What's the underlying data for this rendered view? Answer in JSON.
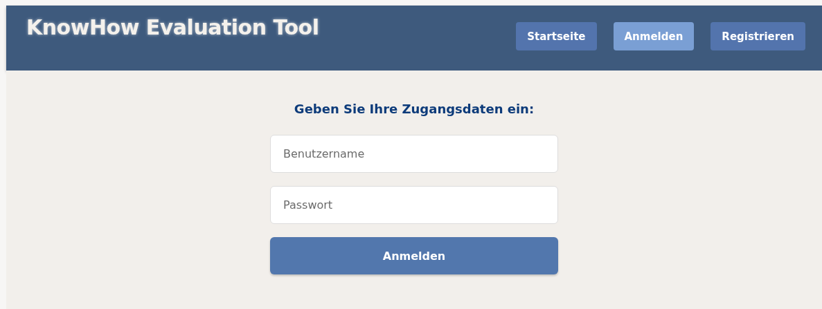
{
  "header": {
    "title": "KnowHow Evaluation Tool",
    "nav": [
      {
        "label": "Startseite",
        "selected": false
      },
      {
        "label": "Anmelden",
        "selected": true
      },
      {
        "label": "Registrieren",
        "selected": false
      }
    ]
  },
  "form": {
    "heading": "Geben Sie Ihre Zugangsdaten ein:",
    "fields": [
      {
        "placeholder": "Benutzername"
      },
      {
        "placeholder": "Passwort"
      }
    ],
    "submit": "Anmelden"
  }
}
